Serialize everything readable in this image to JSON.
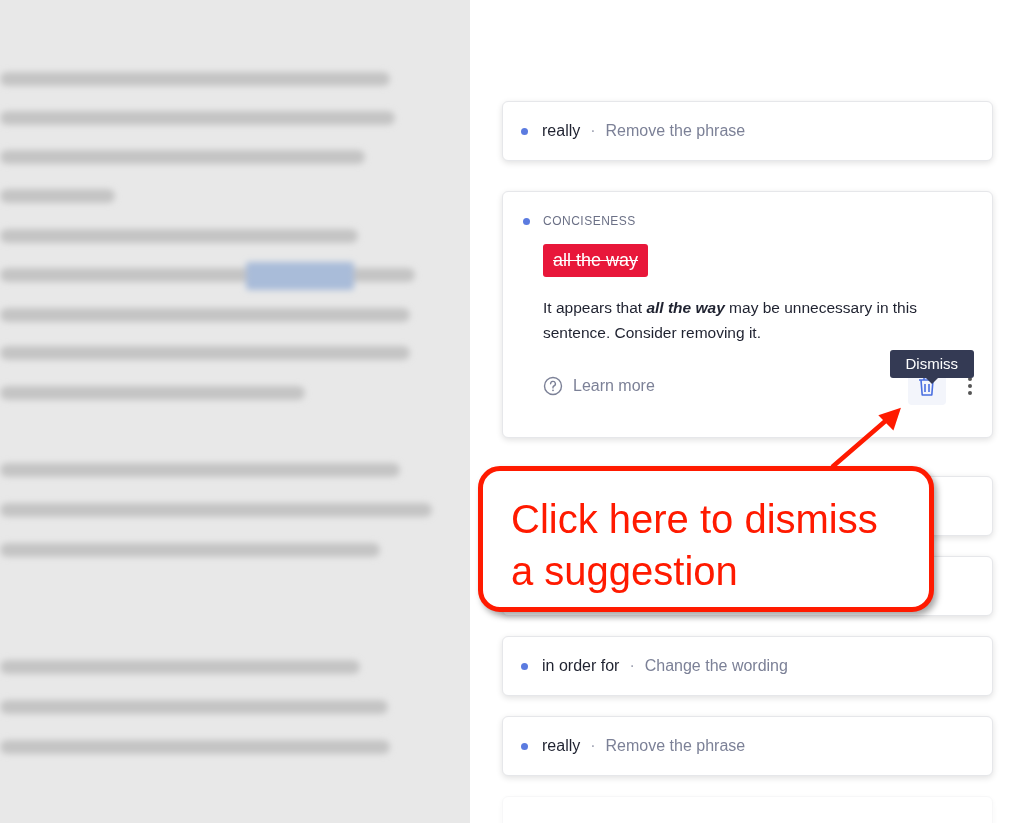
{
  "cards": [
    {
      "kind": "collapsed",
      "phrase": "really",
      "separator": "·",
      "action": "Remove the phrase",
      "color": "#5b7be0"
    },
    {
      "kind": "expanded",
      "category": "CONCISENESS",
      "color": "#5b7be0",
      "strike": "all the way",
      "explanation": "It appears that **all the way** may be unnecessary in this sentence. Consider removing it.",
      "learn_more": "Learn more",
      "tooltip": "Dismiss"
    },
    {
      "kind": "covered"
    },
    {
      "kind": "covered"
    },
    {
      "kind": "collapsed",
      "phrase": "in order for",
      "separator": "·",
      "action": "Change the wording",
      "color": "#5b7be0"
    },
    {
      "kind": "collapsed",
      "phrase": "really",
      "separator": "·",
      "action": "Remove the phrase",
      "color": "#5b7be0"
    },
    {
      "kind": "edge"
    }
  ],
  "callout": {
    "text": "Click here to dismiss a suggestion"
  }
}
